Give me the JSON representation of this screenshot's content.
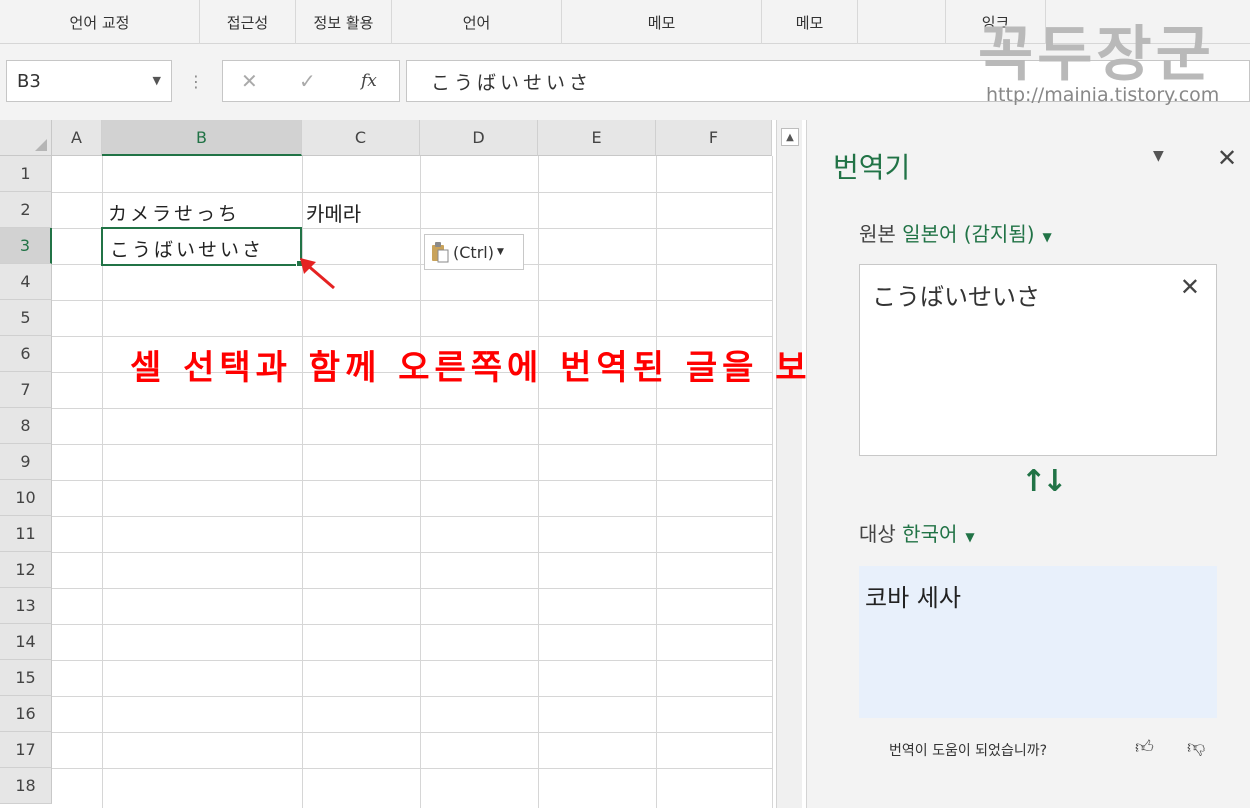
{
  "ribbon": {
    "groups": [
      "언어 교정",
      "접근성",
      "정보 활용",
      "언어",
      "메모",
      "메모",
      "",
      "잉크"
    ]
  },
  "formula_bar": {
    "name_box": "B3",
    "cancel_icon": "✕",
    "enter_icon": "✓",
    "fx_label": "fx",
    "content": "こうばいせいさ"
  },
  "watermark": {
    "title": "꼭두장군",
    "url": "http://mainia.tistory.com"
  },
  "sheet": {
    "columns": [
      "A",
      "B",
      "C",
      "D",
      "E",
      "F"
    ],
    "rows": [
      "1",
      "2",
      "3",
      "4",
      "5",
      "6",
      "7",
      "8",
      "9",
      "10",
      "11",
      "12",
      "13",
      "14",
      "15",
      "16",
      "17",
      "18"
    ],
    "selected_column": "B",
    "selected_row": "3",
    "cells": {
      "B2": "カメラせっち",
      "C2": "카메라",
      "B3": "こうばいせいさ"
    },
    "paste_options_label": "(Ctrl)"
  },
  "annotation": {
    "text": "셀 선택과 함께 오른쪽에 번역된 글을 보여 준다."
  },
  "translator": {
    "title": "번역기",
    "source_label": "원본",
    "source_lang": "일본어 (감지됨)",
    "source_text": "こうばいせいさ",
    "target_label": "대상",
    "target_lang": "한국어",
    "target_text": "코바 세사",
    "feedback_question": "번역이 도움이 되었습니까?"
  },
  "colors": {
    "accent": "#217346",
    "annotation": "#ff0000",
    "target_bg": "#e8f0fb"
  }
}
